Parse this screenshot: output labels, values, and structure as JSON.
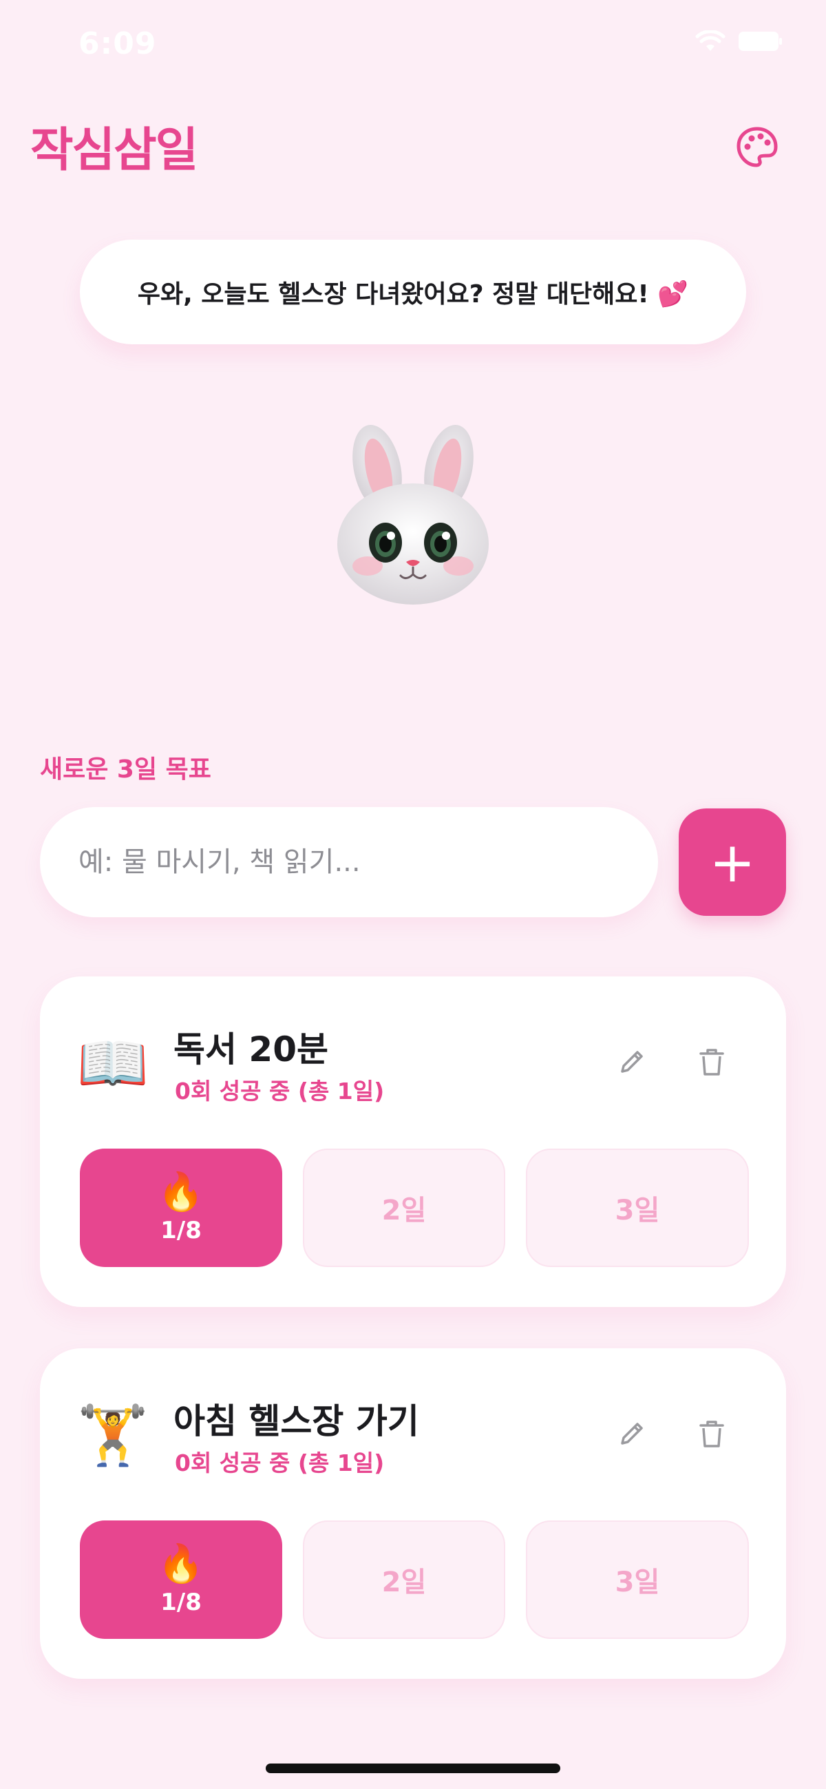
{
  "status_bar": {
    "time": "6:09"
  },
  "header": {
    "title": "작심삼일"
  },
  "bubble": {
    "message": "우와, 오늘도 헬스장 다녀왔어요? 정말 대단해요! 💕"
  },
  "new_goal": {
    "label": "새로운 3일 목표",
    "placeholder": "예: 물 마시기, 책 읽기...",
    "add_label": "+"
  },
  "goals": [
    {
      "emoji": "📖",
      "title": "독서 20분",
      "subtitle": "0회 성공 중 (총 1일)",
      "days": [
        {
          "icon": "🔥",
          "label": "1/8"
        },
        {
          "label": "2일"
        },
        {
          "label": "3일"
        }
      ]
    },
    {
      "emoji": "🏋️",
      "title": "아침 헬스장 가기",
      "subtitle": "0회 성공 중 (총 1일)",
      "days": [
        {
          "icon": "🔥",
          "label": "1/8"
        },
        {
          "label": "2일"
        },
        {
          "label": "3일"
        }
      ]
    }
  ],
  "colors": {
    "accent": "#e7468f",
    "background": "#fdeef6",
    "day_pending_bg": "#fdf0f7",
    "day_pending_text": "#f4a6c9"
  },
  "icons": [
    "wifi-icon",
    "battery-icon",
    "palette-icon",
    "bunny-mascot-icon",
    "pencil-icon",
    "trash-icon",
    "fire-icon"
  ]
}
